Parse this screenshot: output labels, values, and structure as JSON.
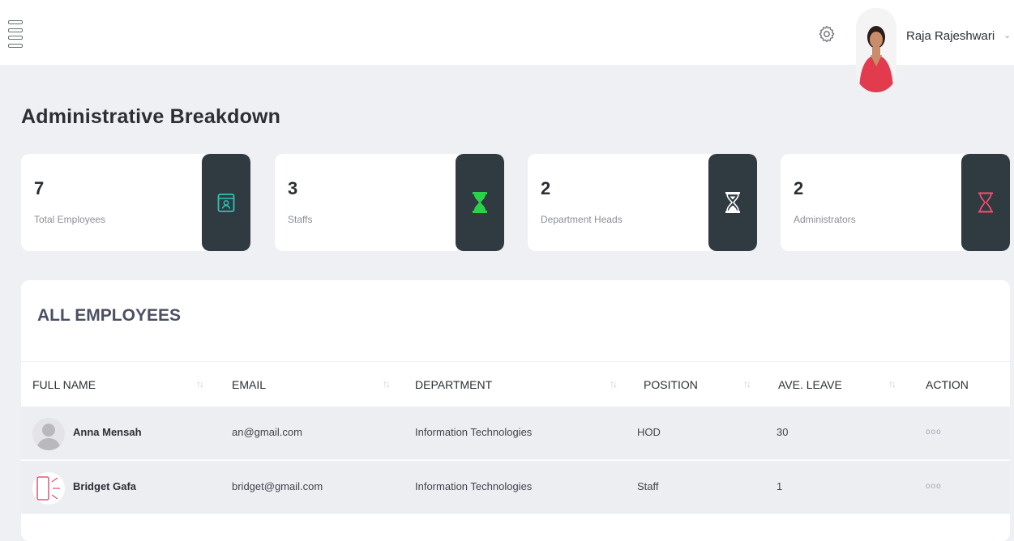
{
  "header": {
    "menu_icon": "hamburger-menu-icon",
    "settings_icon": "gear-icon",
    "user": {
      "name": "Raja Rajeshwari",
      "caret": "⌄"
    }
  },
  "page": {
    "title": "Administrative Breakdown"
  },
  "stats": [
    {
      "value": "7",
      "label": "Total Employees",
      "icon": "id-card-icon",
      "icon_color": "#2ec4b6"
    },
    {
      "value": "3",
      "label": "Staffs",
      "icon": "hourglass-filled-icon",
      "icon_color": "#28d34b"
    },
    {
      "value": "2",
      "label": "Department Heads",
      "icon": "hourglass-half-icon",
      "icon_color": "#ffffff"
    },
    {
      "value": "2",
      "label": "Administrators",
      "icon": "hourglass-outline-icon",
      "icon_color": "#ff4d6d"
    }
  ],
  "table": {
    "title": "ALL EMPLOYEES",
    "columns": [
      "FULL NAME",
      "EMAIL",
      "DEPARTMENT",
      "POSITION",
      "AVE. LEAVE",
      "ACTION"
    ],
    "sort_glyph": "↑↓",
    "rows": [
      {
        "name": "Anna Mensah",
        "email": "an@gmail.com",
        "department": "Information Technologies",
        "position": "HOD",
        "leave": "30",
        "action": "ooo"
      },
      {
        "name": "Bridget Gafa",
        "email": "bridget@gmail.com",
        "department": "Information Technologies",
        "position": "Staff",
        "leave": "1",
        "action": "ooo"
      }
    ]
  }
}
